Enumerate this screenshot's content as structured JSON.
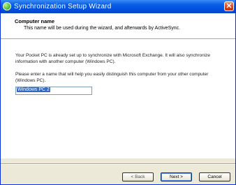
{
  "window": {
    "title": "Synchronization Setup Wizard",
    "close_glyph": "✕"
  },
  "header": {
    "title": "Computer name",
    "subtitle": "This name will be used during the wizard, and afterwards by ActiveSync."
  },
  "content": {
    "paragraph1": "Your Pocket PC is already set up to synchronize with Microsoft Exchange. It will also synchronize information with another computer (Windows PC).",
    "paragraph2": "Please enter a name that will help you easily distinguish this computer from your other computer (Windows PC).",
    "computer_name_value": "Windows PC 2"
  },
  "buttons": {
    "back": "< Back",
    "next": "Next >",
    "cancel": "Cancel"
  },
  "colors": {
    "titlebar": "#0a5ee6",
    "selection": "#316ac5"
  },
  "icons": {
    "app": "activesync-icon",
    "close": "close-icon"
  }
}
